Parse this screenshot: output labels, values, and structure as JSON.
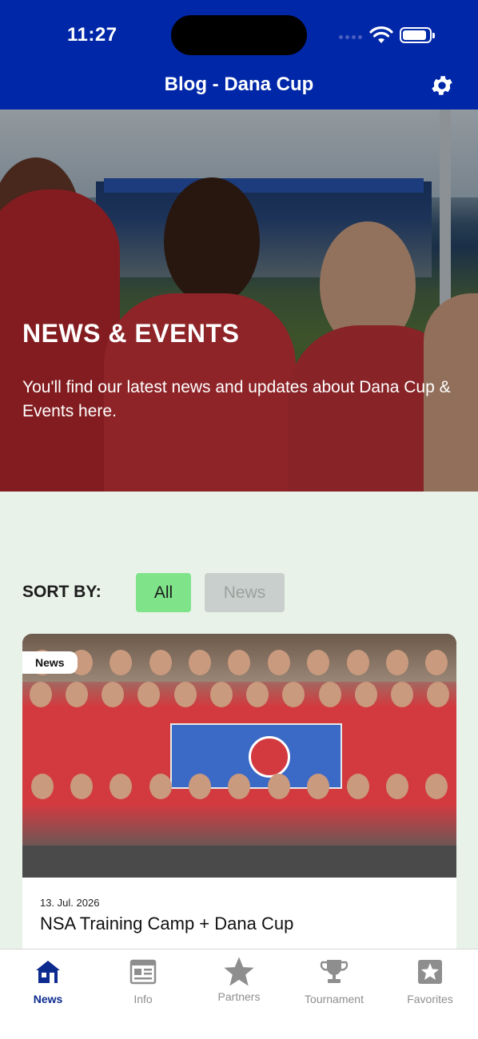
{
  "status_bar": {
    "time": "11:27",
    "battery_level": 0.9
  },
  "header": {
    "title": "Blog - Dana Cup",
    "settings_icon": "gear-icon"
  },
  "hero": {
    "title": "NEWS & EVENTS",
    "subtitle": "You'll find our latest news and updates about Dana Cup & Events here."
  },
  "sort": {
    "label": "SORT BY:",
    "options": [
      {
        "label": "All",
        "selected": true
      },
      {
        "label": "News",
        "selected": false
      }
    ]
  },
  "posts": [
    {
      "category": "News",
      "date": "13. Jul. 2026",
      "title": "NSA Training Camp + Dana Cup"
    }
  ],
  "tabbar": {
    "items": [
      {
        "label": "News",
        "icon": "home-icon",
        "active": true
      },
      {
        "label": "Info",
        "icon": "newspaper-icon",
        "active": false
      },
      {
        "label": "Partners",
        "icon": "star-icon",
        "active": false
      },
      {
        "label": "Tournament",
        "icon": "trophy-icon",
        "active": false
      },
      {
        "label": "Favorites",
        "icon": "favorite-star-icon",
        "active": false
      }
    ]
  },
  "colors": {
    "brand": "#0027a8",
    "accent": "#7fe38a",
    "background": "#e8f2e9"
  }
}
